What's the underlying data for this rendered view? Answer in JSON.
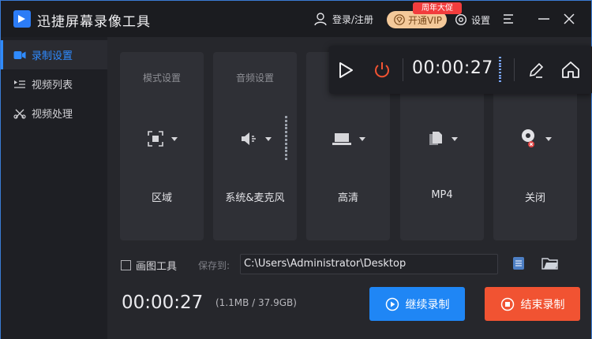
{
  "app": {
    "title": "迅捷屏幕录像工具",
    "logo_icon": "video-camera-icon"
  },
  "header": {
    "login_label": "登录/注册",
    "vip_label": "开通VIP",
    "vip_badge": "周年大促",
    "settings_label": "设置"
  },
  "sidebar": {
    "items": [
      {
        "label": "录制设置",
        "icon": "record-settings-icon",
        "active": true
      },
      {
        "label": "视频列表",
        "icon": "video-list-icon",
        "active": false
      },
      {
        "label": "视频处理",
        "icon": "video-process-icon",
        "active": false
      }
    ]
  },
  "cards": [
    {
      "title": "模式设置",
      "value": "区域",
      "icon": "region-icon"
    },
    {
      "title": "音频设置",
      "value": "系统&麦克风",
      "icon": "speaker-icon"
    },
    {
      "title": "",
      "value": "高清",
      "icon": "laptop-icon"
    },
    {
      "title": "",
      "value": "MP4",
      "icon": "file-format-icon"
    },
    {
      "title": "",
      "value": "关闭",
      "icon": "camera-off-icon"
    }
  ],
  "floatbar": {
    "time": "00:00:27"
  },
  "bottom": {
    "draw_tool_label": "画图工具",
    "save_label": "保存到:",
    "save_path": "C:\\Users\\Administrator\\Desktop",
    "elapsed": "00:00:27",
    "size_info": "(1.1MB / 37.9GB)",
    "continue_label": "继续录制",
    "stop_label": "结束录制"
  },
  "colors": {
    "accent": "#2f8bff",
    "stop": "#f15332",
    "vip": "#f4c99a",
    "badge": "#f23d3d"
  }
}
